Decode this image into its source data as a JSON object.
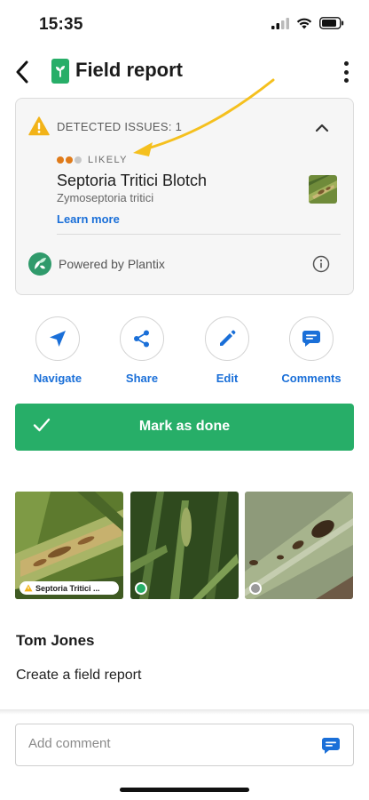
{
  "status_bar": {
    "time": "15:35"
  },
  "header": {
    "title": "Field report",
    "back_icon": "chevron-left-icon",
    "menu_icon": "more-vertical-icon"
  },
  "issue_card": {
    "issues_label": "DETECTED ISSUES: 1",
    "likelihood": "LIKELY",
    "likelihood_colors": [
      "#e07b1a",
      "#e07b1a",
      "#c8c8c8"
    ],
    "disease_name": "Septoria Tritici Blotch",
    "disease_latin": "Zymoseptoria tritici",
    "learn_more": "Learn more",
    "powered_by": "Powered by Plantix"
  },
  "actions": [
    {
      "label": "Navigate",
      "icon": "navigate-arrow-icon"
    },
    {
      "label": "Share",
      "icon": "share-icon"
    },
    {
      "label": "Edit",
      "icon": "pencil-icon"
    },
    {
      "label": "Comments",
      "icon": "comment-bubble-icon"
    }
  ],
  "mark_done": {
    "label": "Mark as done"
  },
  "photos": {
    "first_badge": "Septoria Tritici ...",
    "status_colors": [
      "#27ae68",
      "#9a9a9a"
    ]
  },
  "report": {
    "author": "Tom Jones",
    "note": "Create a field report"
  },
  "comment": {
    "placeholder": "Add comment"
  },
  "colors": {
    "accent_blue": "#1a6fd8",
    "accent_green": "#27ae68",
    "warning": "#f2b318",
    "annotation_arrow": "#f5c01e"
  }
}
